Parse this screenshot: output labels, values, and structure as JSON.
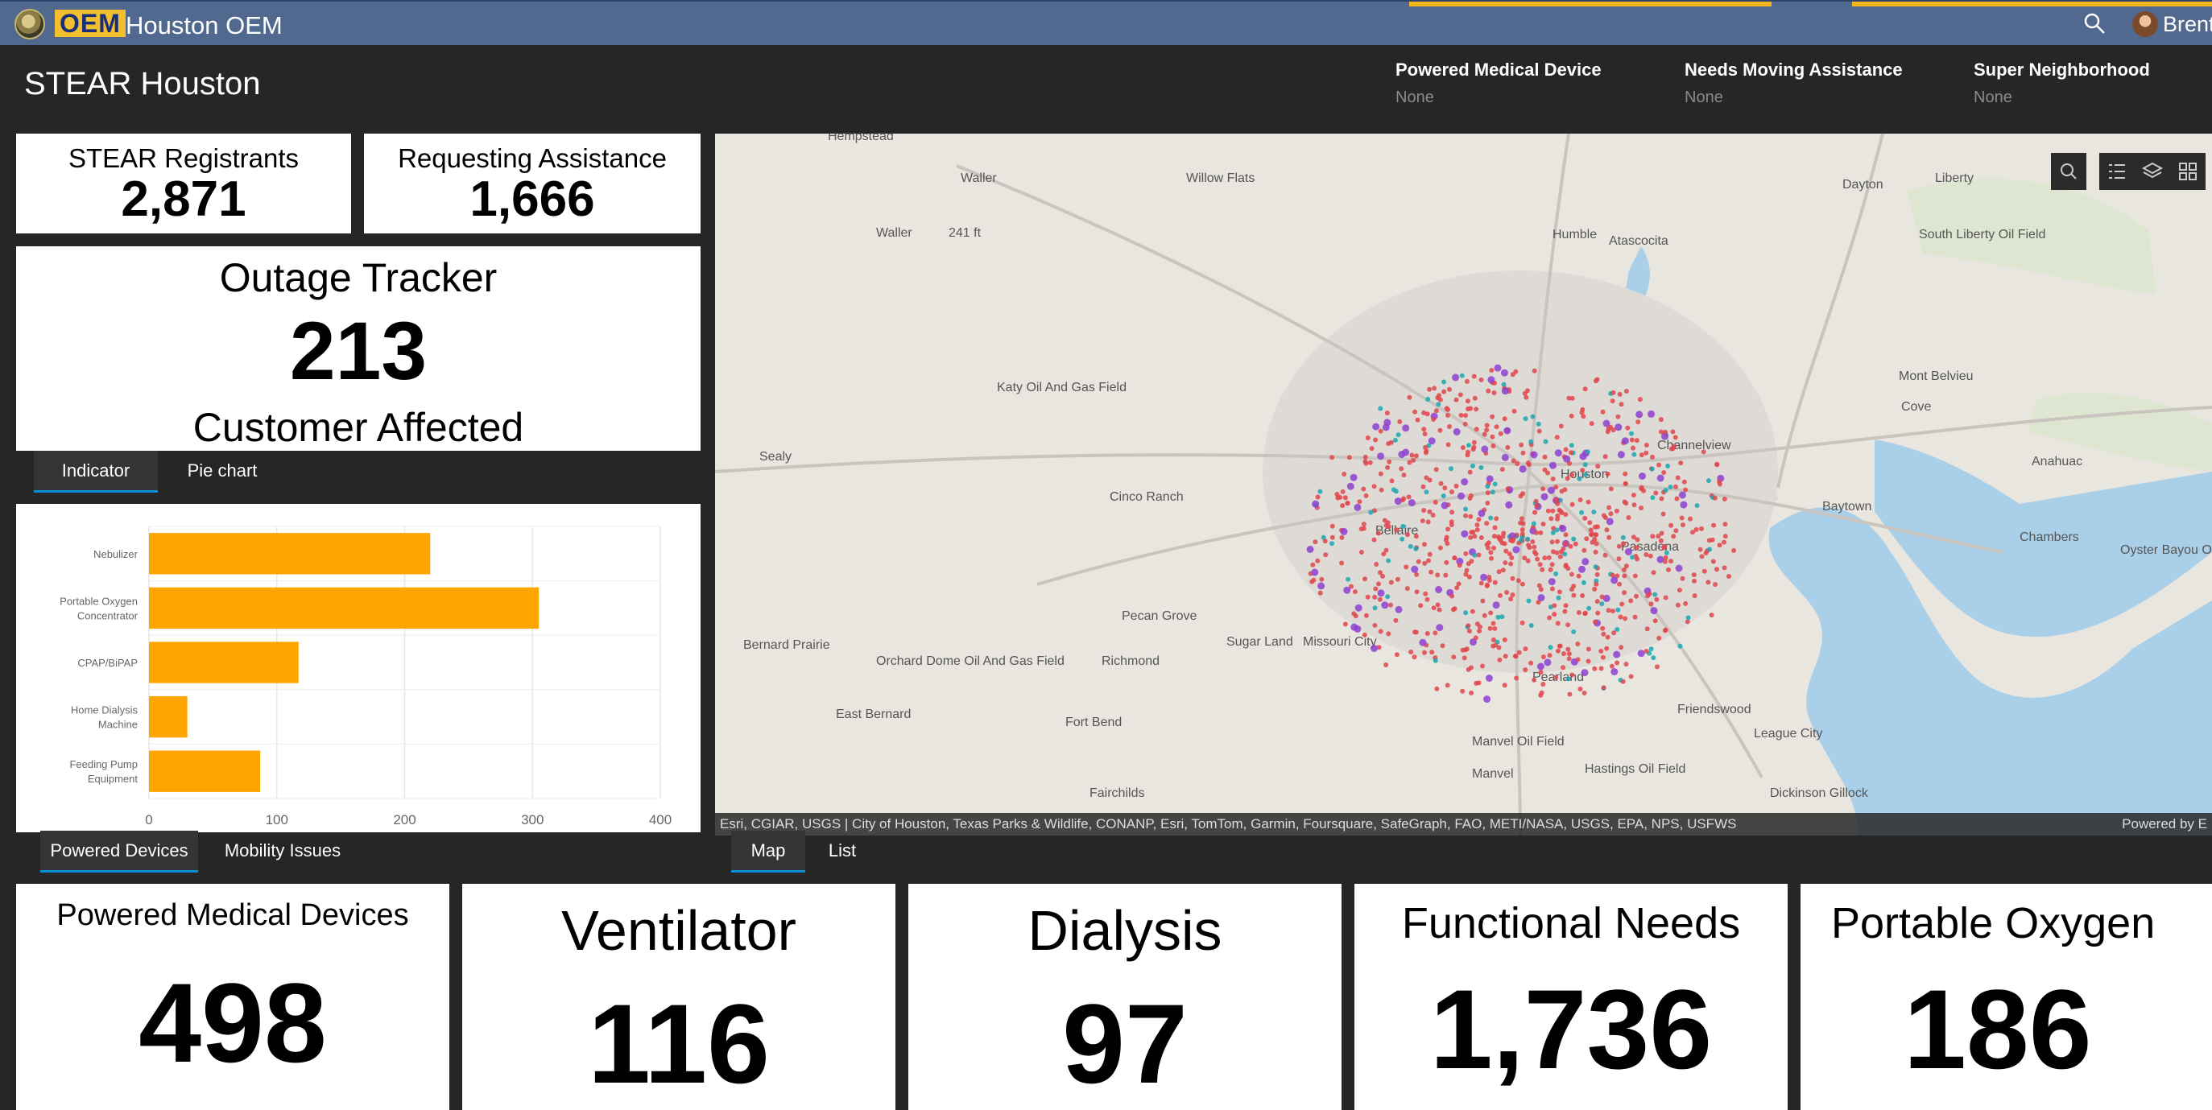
{
  "appbar": {
    "logo_text": "OEM",
    "title": "Houston OEM",
    "user_name": "Brent"
  },
  "header": {
    "title": "STEAR Houston",
    "filters": [
      {
        "label": "Powered Medical Device",
        "value": "None"
      },
      {
        "label": "Needs Moving Assistance",
        "value": "None"
      },
      {
        "label": "Super Neighborhood",
        "value": "None"
      }
    ]
  },
  "kpis": {
    "registrants": {
      "label": "STEAR Registrants",
      "value": "2,871"
    },
    "requesting": {
      "label": "Requesting Assistance",
      "value": "1,666"
    }
  },
  "outage": {
    "title": "Outage Tracker",
    "value": "213",
    "caption": "Customer Affected"
  },
  "chart_tabs": [
    "Indicator",
    "Pie chart"
  ],
  "chart_data": {
    "type": "bar",
    "orientation": "horizontal",
    "categories": [
      "Nebulizer",
      "Portable Oxygen Concentrator",
      "CPAP/BiPAP",
      "Home Dialysis Machine",
      "Feeding Pump Equipment"
    ],
    "values": [
      220,
      305,
      117,
      30,
      87
    ],
    "xlim": [
      0,
      400
    ],
    "xticks": [
      "0",
      "100",
      "200",
      "300",
      "400"
    ],
    "grid": true,
    "color": "#ffa500"
  },
  "bottom_left_tabs": [
    "Powered Devices",
    "Mobility Issues"
  ],
  "map_tabs": [
    "Map",
    "List"
  ],
  "map": {
    "labels": [
      "Hempstead",
      "Waller",
      "Willow Flats",
      "Waller",
      "241 ft",
      "Humble",
      "Atascocita",
      "Dayton",
      "Liberty",
      "South Liberty Oil Field",
      "Katy Oil And Gas Field",
      "Mont Belvieu",
      "Cove",
      "Sealy",
      "Channelview",
      "Anahuac",
      "Cinco Ranch",
      "Houston",
      "Baytown",
      "Bellaire",
      "Pasadena",
      "Chambers",
      "Oyster Bayou Oil Field",
      "Pecan Grove",
      "Bernard Prairie",
      "Orchard Dome Oil And Gas Field",
      "Richmond",
      "Sugar Land",
      "Missouri City",
      "Pearland",
      "East Bernard",
      "Fort Bend",
      "Friendswood",
      "League City",
      "Manvel Oil Field",
      "Manvel",
      "Hastings Oil Field",
      "Fairchilds",
      "Dickinson Gillock"
    ],
    "attribution": "Esri, CGIAR, USGS | City of Houston, Texas Parks & Wildlife, CONANP, Esri, TomTom, Garmin, Foursquare, SafeGraph, FAO, METI/NASA, USGS, EPA, NPS, USFWS",
    "powered_by": "Powered by E"
  },
  "big_kpis": [
    {
      "label": "Powered Medical Devices",
      "value": "498"
    },
    {
      "label": "Ventilator",
      "value": "116"
    },
    {
      "label": "Dialysis",
      "value": "97"
    },
    {
      "label": "Functional Needs",
      "value": "1,736"
    },
    {
      "label": "Portable Oxygen",
      "value": "186"
    }
  ]
}
